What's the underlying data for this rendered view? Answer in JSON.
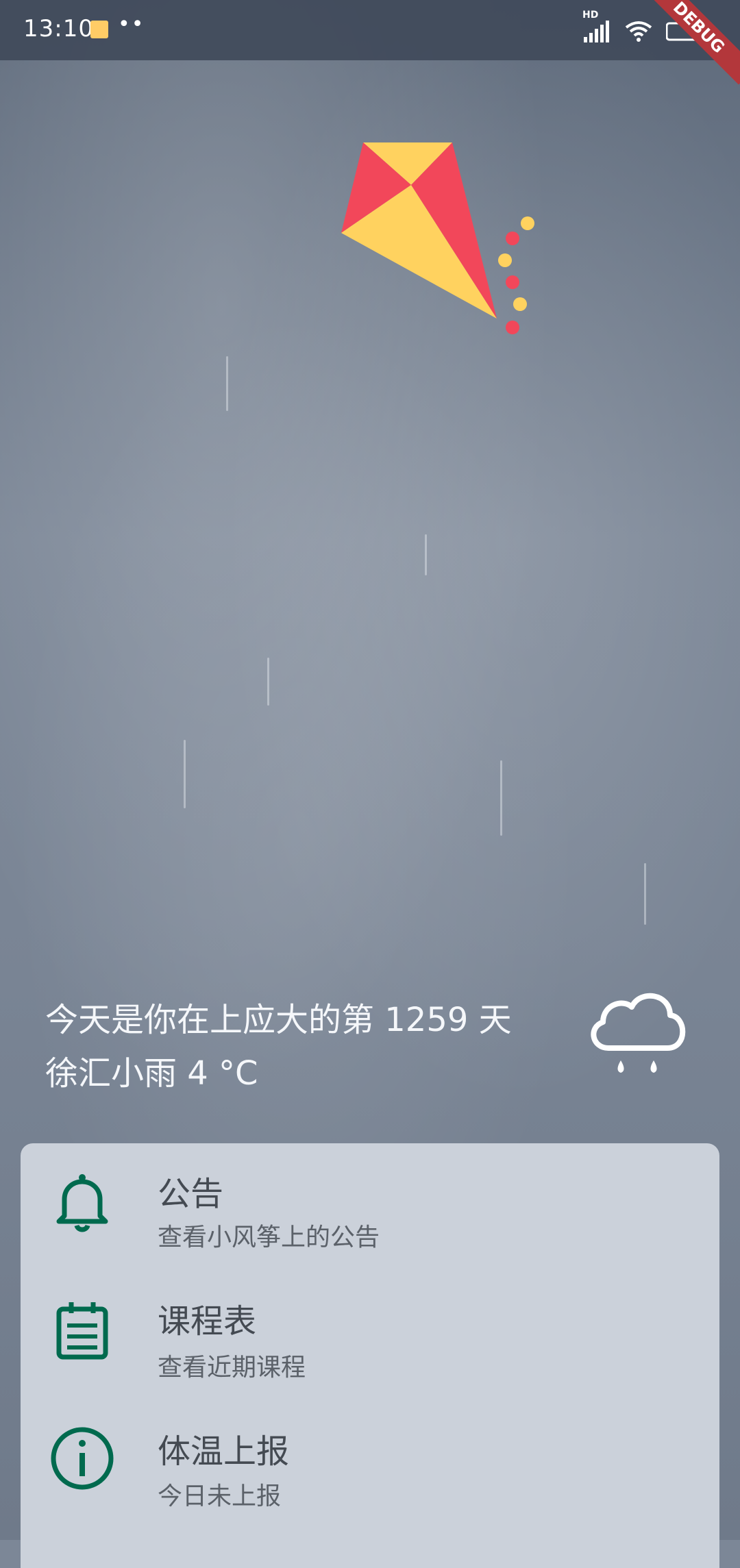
{
  "status_bar": {
    "time": "13:10",
    "dots": "••",
    "network_label": "HD",
    "debug_label": "DEBUG"
  },
  "info": {
    "days_line": "今天是你在上应大的第 1259 天",
    "weather_line": "徐汇小雨  4 °C"
  },
  "menu": {
    "items": [
      {
        "title": "公告",
        "subtitle": "查看小风筝上的公告",
        "icon": "bell-icon"
      },
      {
        "title": "课程表",
        "subtitle": "查看近期课程",
        "icon": "calendar-icon"
      },
      {
        "title": "体温上报",
        "subtitle": "今日未上报",
        "icon": "info-icon"
      }
    ]
  },
  "colors": {
    "accent_green": "#006a4e",
    "kite_red": "#f2475a",
    "kite_yellow": "#ffd25f",
    "card_bg": "#cbd1da"
  }
}
